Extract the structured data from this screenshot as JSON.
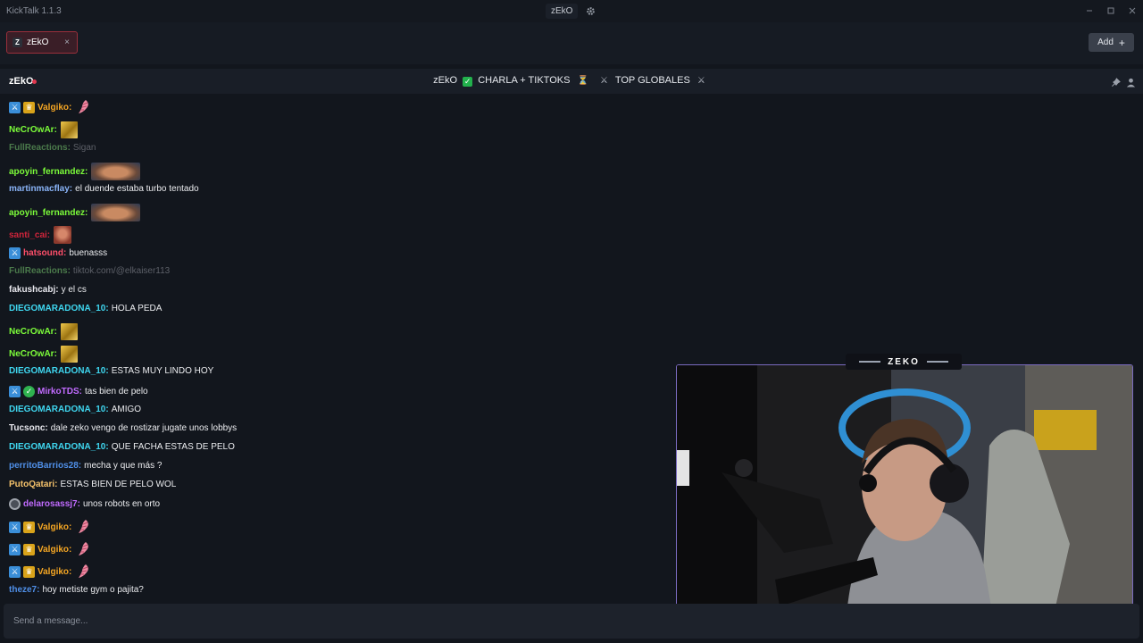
{
  "app": {
    "title": "KickTalk 1.1.3",
    "center_chip": "zEkO"
  },
  "tabs": [
    {
      "label": "zEkO",
      "avatar_letter": "Z"
    }
  ],
  "tab_close": "×",
  "add_button": {
    "label": "Add",
    "icon": "+"
  },
  "channel": {
    "name": "zEkO",
    "stream_title": {
      "part1": "zEkO",
      "check": "✓",
      "part2": "CHARLA + TIKTOKS",
      "hourglass": "⏳",
      "swords1": "⚔",
      "part3": "TOP GLOBALES",
      "swords2": "⚔"
    }
  },
  "messages": [
    {
      "user": "Valgiko:",
      "text": "",
      "color": "#f5a623",
      "badges": [
        "sword",
        "crown"
      ],
      "emote": "shrimp"
    },
    {
      "user": "NeCrOwAr:",
      "text": "",
      "color": "#7cfc3a",
      "badges": [],
      "emote": "gold"
    },
    {
      "user": "FullReactions:",
      "text": "Sigan",
      "color": "#4b7a4b",
      "text_color": "#5d6068",
      "badges": [],
      "emote": ""
    },
    {
      "user": "apoyin_fernandez:",
      "text": "",
      "color": "#7cfc3a",
      "badges": [],
      "emote": "face"
    },
    {
      "user": "martinmacflay:",
      "text": "el duende estaba turbo tentado",
      "color": "#8ab4f8",
      "badges": [],
      "emote": ""
    },
    {
      "user": "apoyin_fernandez:",
      "text": "",
      "color": "#7cfc3a",
      "badges": [],
      "emote": "face"
    },
    {
      "user": "santi_cai:",
      "text": "",
      "color": "#d0243b",
      "badges": [],
      "emote": "red"
    },
    {
      "user": "hatsound:",
      "text": "buenasss",
      "color": "#ff4f6a",
      "badges": [
        "sword"
      ],
      "emote": ""
    },
    {
      "user": "FullReactions:",
      "text": "tiktok.com/@elkaiser113",
      "color": "#4b7a4b",
      "text_color": "#5d6068",
      "badges": [],
      "emote": ""
    },
    {
      "user": "fakushcabj:",
      "text": "y el cs",
      "color": "#e8e8ee",
      "badges": [],
      "emote": ""
    },
    {
      "user": "DIEGOMARADONA_10:",
      "text": "HOLA PEDA",
      "color": "#3fd7f0",
      "badges": [],
      "emote": ""
    },
    {
      "user": "NeCrOwAr:",
      "text": "",
      "color": "#7cfc3a",
      "badges": [],
      "emote": "gold"
    },
    {
      "user": "NeCrOwAr:",
      "text": "",
      "color": "#7cfc3a",
      "badges": [],
      "emote": "gold"
    },
    {
      "user": "DIEGOMARADONA_10:",
      "text": "ESTAS MUY LINDO HOY",
      "color": "#3fd7f0",
      "badges": [],
      "emote": ""
    },
    {
      "user": "MirkoTDS:",
      "text": "tas bien de pelo",
      "color": "#c16bff",
      "badges": [
        "sword",
        "verified"
      ],
      "emote": ""
    },
    {
      "user": "DIEGOMARADONA_10:",
      "text": "AMIGO",
      "color": "#3fd7f0",
      "badges": [],
      "emote": ""
    },
    {
      "user": "Tucsonc:",
      "text": "dale zeko vengo de rostizar jugate unos lobbys",
      "color": "#e8e8ee",
      "badges": [],
      "emote": ""
    },
    {
      "user": "DIEGOMARADONA_10:",
      "text": "QUE FACHA ESTAS DE PELO",
      "color": "#3fd7f0",
      "badges": [],
      "emote": ""
    },
    {
      "user": "perritoBarrios28:",
      "text": "mecha y que más ?",
      "color": "#4f8fe8",
      "badges": [],
      "emote": ""
    },
    {
      "user": "PutoQatari:",
      "text": "ESTAS BIEN DE PELO WOL",
      "color": "#f5c26b",
      "badges": [],
      "emote": ""
    },
    {
      "user": "delarosassj7:",
      "text": "unos robots en orto",
      "color": "#c16bff",
      "badges": [
        "ring"
      ],
      "emote": ""
    },
    {
      "user": "Valgiko:",
      "text": "",
      "color": "#f5a623",
      "badges": [
        "sword",
        "crown"
      ],
      "emote": "shrimp"
    },
    {
      "user": "Valgiko:",
      "text": "",
      "color": "#f5a623",
      "badges": [
        "sword",
        "crown"
      ],
      "emote": "shrimp"
    },
    {
      "user": "Valgiko:",
      "text": "",
      "color": "#f5a623",
      "badges": [
        "sword",
        "crown"
      ],
      "emote": "shrimp"
    },
    {
      "user": "theze7:",
      "text": "hoy metiste gym o pajita?",
      "color": "#4f8fe8",
      "badges": [],
      "emote": ""
    }
  ],
  "input": {
    "placeholder": "Send a message..."
  },
  "stream_overlay": {
    "label": "ZEKO"
  },
  "colors": {
    "background": "#12161d",
    "accent_tab": "#9a2f3b",
    "live": "#e0384f"
  }
}
